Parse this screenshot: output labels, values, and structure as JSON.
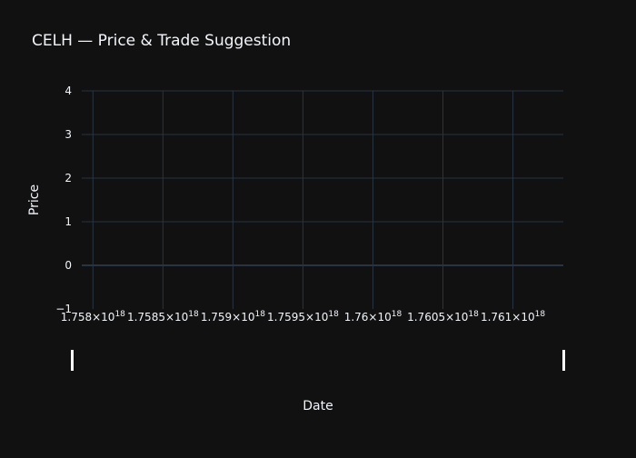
{
  "chart_data": {
    "type": "line",
    "title": "CELH — Price & Trade Suggestion",
    "xlabel": "Date",
    "ylabel": "Price",
    "x_ticks": [
      {
        "value": 1.758e+18,
        "mantissa": "1.758",
        "exponent": "18"
      },
      {
        "value": 1.7585e+18,
        "mantissa": "1.7585",
        "exponent": "18"
      },
      {
        "value": 1.759e+18,
        "mantissa": "1.759",
        "exponent": "18"
      },
      {
        "value": 1.7595e+18,
        "mantissa": "1.7595",
        "exponent": "18"
      },
      {
        "value": 1.76e+18,
        "mantissa": "1.76",
        "exponent": "18"
      },
      {
        "value": 1.7605e+18,
        "mantissa": "1.7605",
        "exponent": "18"
      },
      {
        "value": 1.761e+18,
        "mantissa": "1.761",
        "exponent": "18"
      }
    ],
    "y_ticks": [
      {
        "value": -1,
        "label": "−1"
      },
      {
        "value": 0,
        "label": "0"
      },
      {
        "value": 1,
        "label": "1"
      },
      {
        "value": 2,
        "label": "2"
      },
      {
        "value": 3,
        "label": "3"
      },
      {
        "value": 4,
        "label": "4"
      }
    ],
    "xlim": [
      1.75792e+18,
      1.76136e+18
    ],
    "ylim": [
      -1,
      4
    ],
    "series": [],
    "grid": true,
    "range_slider": true,
    "colors": {
      "background": "#111111",
      "grid": "#283442",
      "zeroline": "#283442",
      "text": "#f2f5fa",
      "handle": "#ffffff"
    }
  }
}
